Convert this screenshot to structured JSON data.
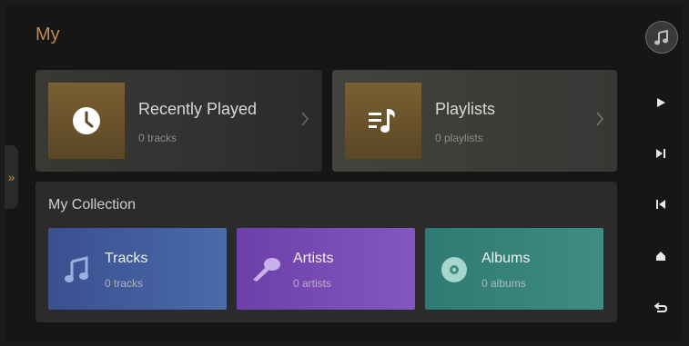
{
  "header": {
    "title": "My"
  },
  "cards": {
    "recent": {
      "label": "Recently Played",
      "sub": "0 tracks",
      "icon": "clock-icon"
    },
    "playlists": {
      "label": "Playlists",
      "sub": "0 playlists",
      "icon": "playlist-icon"
    }
  },
  "collection": {
    "title": "My Collection",
    "tiles": [
      {
        "label": "Tracks",
        "sub": "0 tracks",
        "icon": "music-note-icon",
        "color": "#3a5090"
      },
      {
        "label": "Artists",
        "sub": "0 artists",
        "icon": "microphone-icon",
        "color": "#6d3fa8"
      },
      {
        "label": "Albums",
        "sub": "0 albums",
        "icon": "disc-icon",
        "color": "#2f7a73"
      }
    ]
  },
  "sidebar": {
    "buttons": [
      "now-playing-disc-icon",
      "play-icon",
      "next-icon",
      "previous-icon",
      "home-icon",
      "back-icon"
    ]
  },
  "colors": {
    "accent": "#c08a4c",
    "background": "#161616",
    "panel": "#2b2b2b"
  }
}
